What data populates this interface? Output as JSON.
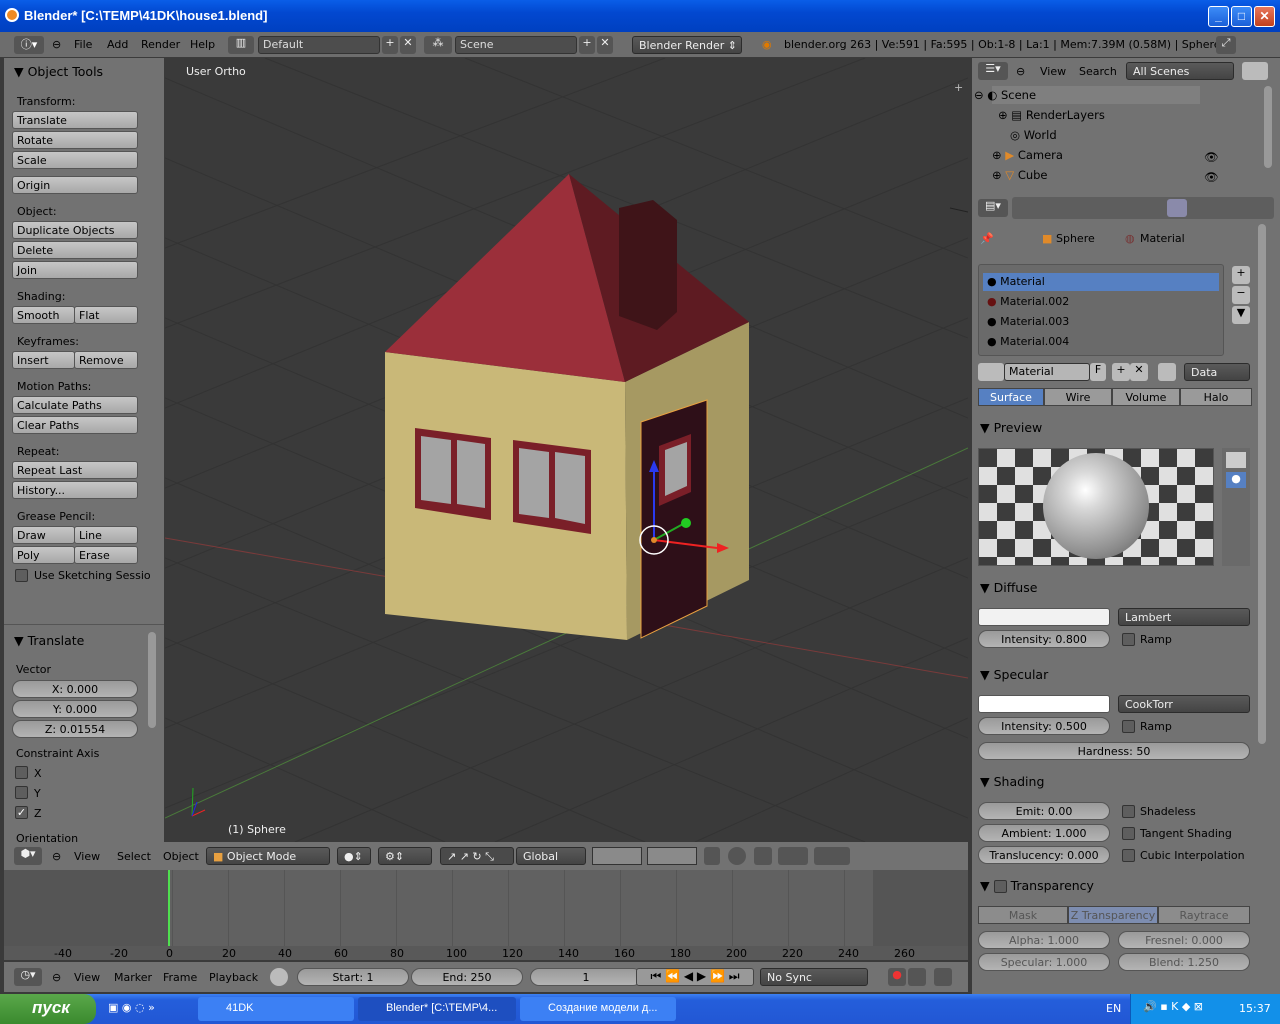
{
  "window": {
    "title": "Blender* [C:\\TEMP\\41DK\\house1.blend]"
  },
  "infobar": {
    "menus": [
      "File",
      "Add",
      "Render",
      "Help"
    ],
    "layout": "Default",
    "scene": "Scene",
    "engine": "Blender Render",
    "stats": "blender.org 263 | Ve:591 | Fa:595 | Ob:1-8 | La:1 | Mem:7.39M (0.58M) | Sphere"
  },
  "tools": {
    "title": "Object Tools",
    "transform": "Transform:",
    "translate": "Translate",
    "rotate": "Rotate",
    "scale": "Scale",
    "origin": "Origin",
    "object": "Object:",
    "duplicate": "Duplicate Objects",
    "delete": "Delete",
    "join": "Join",
    "shading": "Shading:",
    "smooth": "Smooth",
    "flat": "Flat",
    "keyframes": "Keyframes:",
    "insert": "Insert",
    "remove": "Remove",
    "motion_paths": "Motion Paths:",
    "calc_paths": "Calculate Paths",
    "clear_paths": "Clear Paths",
    "repeat": "Repeat:",
    "repeat_last": "Repeat Last",
    "history": "History...",
    "grease": "Grease Pencil:",
    "draw": "Draw",
    "line": "Line",
    "poly": "Poly",
    "erase": "Erase",
    "sketching": "Use Sketching Sessio"
  },
  "operator": {
    "title": "Translate",
    "vector": "Vector",
    "x": "X: 0.000",
    "y": "Y: 0.000",
    "z": "Z: 0.01554",
    "constraint": "Constraint Axis",
    "cx": "X",
    "cy": "Y",
    "cz": "Z",
    "orientation": "Orientation"
  },
  "viewport": {
    "view_name": "User Ortho",
    "object_name": "(1) Sphere"
  },
  "view_header": {
    "menus": [
      "View",
      "Select",
      "Object"
    ],
    "mode": "Object Mode",
    "orientation": "Global"
  },
  "timeline": {
    "ticks": [
      "-40",
      "-20",
      "0",
      "20",
      "40",
      "60",
      "80",
      "100",
      "120",
      "140",
      "160",
      "180",
      "200",
      "220",
      "240",
      "260"
    ],
    "menus": [
      "View",
      "Marker",
      "Frame",
      "Playback"
    ],
    "start": "Start: 1",
    "end": "End: 250",
    "frame": "1",
    "sync": "No Sync"
  },
  "outliner": {
    "menus": [
      "View",
      "Search"
    ],
    "filter": "All Scenes",
    "items": [
      "Scene",
      "RenderLayers",
      "World",
      "Camera",
      "Cube"
    ]
  },
  "properties": {
    "breadcrumb_object": "Sphere",
    "breadcrumb_material": "Material",
    "materials": [
      "Material",
      "Material.002",
      "Material.003",
      "Material.004"
    ],
    "material_name": "Material",
    "fake_user": "F",
    "link": "Data",
    "tabs": [
      "Surface",
      "Wire",
      "Volume",
      "Halo"
    ],
    "preview": "Preview",
    "diffuse": "Diffuse",
    "diffuse_shader": "Lambert",
    "diffuse_intensity": "Intensity: 0.800",
    "ramp": "Ramp",
    "specular": "Specular",
    "specular_shader": "CookTorr",
    "specular_intensity": "Intensity: 0.500",
    "hardness": "Hardness: 50",
    "shading": "Shading",
    "emit": "Emit: 0.00",
    "ambient": "Ambient: 1.000",
    "translucency": "Translucency: 0.000",
    "shadeless": "Shadeless",
    "tangent": "Tangent Shading",
    "cubic": "Cubic Interpolation",
    "transparency": "Transparency",
    "mask": "Mask",
    "ztrans": "Z Transparency",
    "raytrace": "Raytrace",
    "alpha": "Alpha: 1.000",
    "fresnel": "Fresnel: 0.000",
    "spec_t": "Specular: 1.000",
    "blend": "Blend: 1.250"
  },
  "taskbar": {
    "start": "пуск",
    "tasks": [
      "41DK",
      "Blender* [C:\\TEMP\\4...",
      "Создание модели д..."
    ],
    "lang": "EN",
    "time": "15:37"
  }
}
